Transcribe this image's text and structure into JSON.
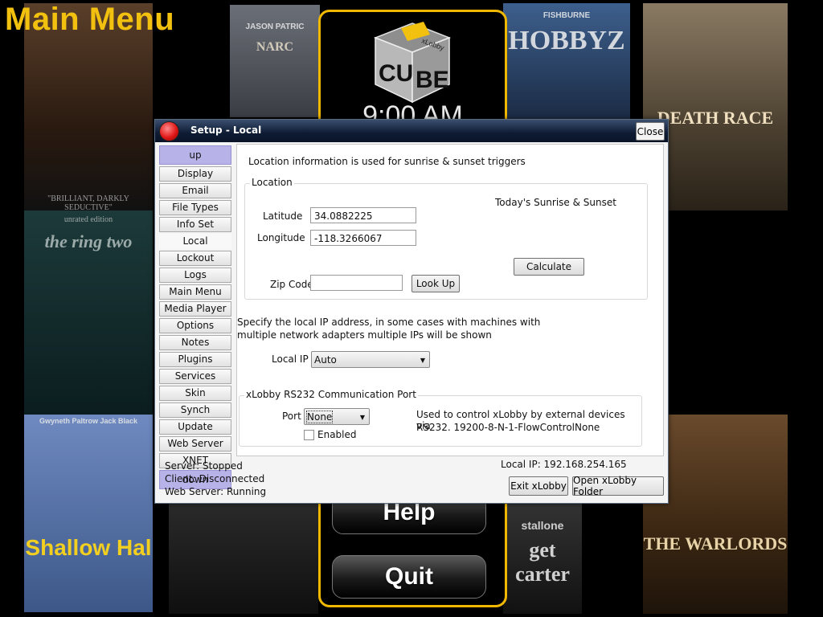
{
  "background": {
    "title": "Main Menu",
    "posters": [
      {
        "text": "",
        "sub": "\"BRILLIANT, DARKLY SEDUCTIVE\"",
        "actors": ""
      },
      {
        "text": "NARC",
        "sub": "",
        "actors": "JASON PATRIC"
      },
      {
        "text": "HOBBYZ",
        "sub": "",
        "actors": "FISHBURNE"
      },
      {
        "text": "DEATH RACE",
        "sub": "",
        "actors": ""
      },
      {
        "text": "the ring two",
        "sub": "unrated edition",
        "actors": ""
      },
      {
        "text": "Shallow Hal",
        "sub": "",
        "actors": "Gwyneth Paltrow  Jack Black"
      },
      {
        "text": "get carter",
        "sub": "",
        "actors": "stallone"
      },
      {
        "text": "THE WARLORDS",
        "sub": "",
        "actors": ""
      }
    ],
    "menu_clock": "9:00 AM",
    "menu_buttons": {
      "help": "Help",
      "quit": "Quit"
    },
    "cube_letters": [
      "CU",
      "BE"
    ],
    "cube_brand": "xLobby"
  },
  "dialog": {
    "title": "Setup - Local",
    "close_label": "Close",
    "nav": {
      "up": "up",
      "down": "down",
      "selected": "Local",
      "items": [
        "Display",
        "Email",
        "File Types",
        "Info Set",
        "Local",
        "Lockout",
        "Logs",
        "Main Menu",
        "Media Player",
        "Options",
        "Notes",
        "Plugins",
        "Services",
        "Skin",
        "Synch",
        "Update",
        "Web Server",
        "XNET"
      ]
    },
    "content": {
      "intro": "Location information is used for sunrise & sunset triggers",
      "location": {
        "group_label": "Location",
        "latitude_label": "Latitude",
        "latitude_value": "34.0882225",
        "longitude_label": "Longitude",
        "longitude_value": "-118.3266067",
        "sunrise_label": "Today's Sunrise & Sunset",
        "calculate_label": "Calculate",
        "zip_label": "Zip Code",
        "zip_value": "",
        "lookup_label": "Look Up"
      },
      "ip_note_line1": "Specify the local IP address, in some cases with machines with",
      "ip_note_line2": "multiple network adapters multiple IPs will be shown",
      "local_ip_label": "Local IP",
      "local_ip_value": "Auto",
      "rs232": {
        "group_label": "xLobby RS232 Communication Port",
        "port_label": "Port",
        "port_value": "None",
        "enabled_label": "Enabled",
        "enabled_checked": false,
        "desc_line1": "Used to control xLobby by external devices via",
        "desc_line2": "RS232. 19200-8-N-1-FlowControlNone"
      }
    },
    "status": {
      "server": "Server: Stopped",
      "client": "Client: Disconnected",
      "web_server": "Web Server: Running",
      "local_ip": "Local IP: 192.168.254.165"
    },
    "footer": {
      "exit_label": "Exit xLobby",
      "open_folder_label": "Open xLobby Folder"
    }
  }
}
